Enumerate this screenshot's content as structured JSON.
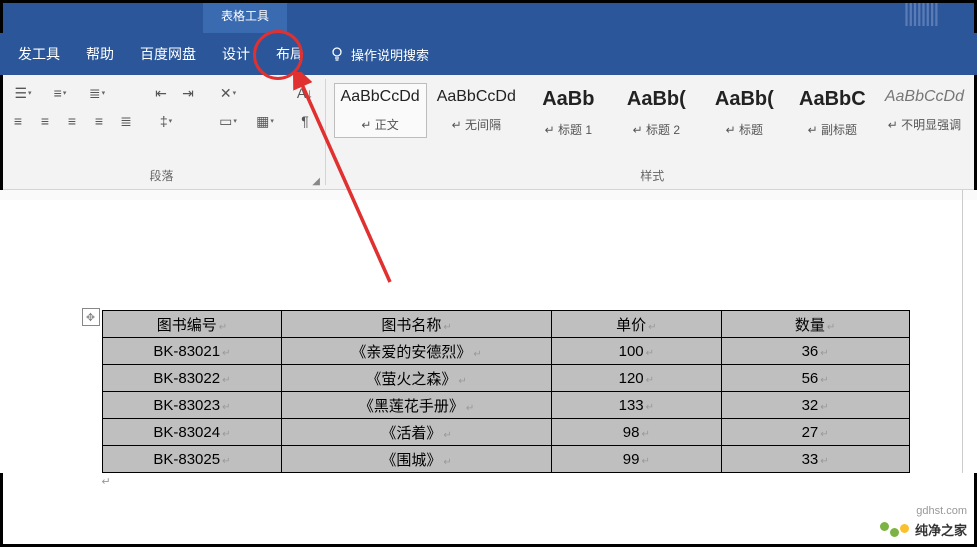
{
  "titlebar": {
    "context_group": "表格工具"
  },
  "tabs": {
    "dev": "发工具",
    "help": "帮助",
    "baidu": "百度网盘",
    "design": "设计",
    "layout": "布局",
    "search_hint": "操作说明搜索"
  },
  "ribbon": {
    "paragraph_label": "段落",
    "styles_label": "样式",
    "styles": [
      {
        "preview": "AaBbCcDd",
        "label": "正文",
        "cls": "sel",
        "prevcls": ""
      },
      {
        "preview": "AaBbCcDd",
        "label": "无间隔",
        "cls": "",
        "prevcls": ""
      },
      {
        "preview": "AaBb",
        "label": "标题 1",
        "cls": "",
        "prevcls": "bold"
      },
      {
        "preview": "AaBb(",
        "label": "标题 2",
        "cls": "",
        "prevcls": "bold"
      },
      {
        "preview": "AaBb(",
        "label": "标题",
        "cls": "",
        "prevcls": "bold"
      },
      {
        "preview": "AaBbC",
        "label": "副标题",
        "cls": "",
        "prevcls": "bold"
      },
      {
        "preview": "AaBbCcDd",
        "label": "不明显强调",
        "cls": "",
        "prevcls": "italic"
      }
    ]
  },
  "table": {
    "headers": [
      "图书编号",
      "图书名称",
      "单价",
      "数量"
    ],
    "rows": [
      [
        "BK-83021",
        "《亲爱的安德烈》",
        "100",
        "36"
      ],
      [
        "BK-83022",
        "《萤火之森》",
        "120",
        "56"
      ],
      [
        "BK-83023",
        "《黑莲花手册》",
        "133",
        "32"
      ],
      [
        "BK-83024",
        "《活着》",
        "98",
        "27"
      ],
      [
        "BK-83025",
        "《围城》",
        "99",
        "33"
      ]
    ]
  },
  "watermark": {
    "text": "纯净之家",
    "sub": "gdhst.com"
  },
  "colors": {
    "brand": "#2b579a",
    "annotation": "#e03030",
    "table_bg": "#bfbfbf"
  }
}
